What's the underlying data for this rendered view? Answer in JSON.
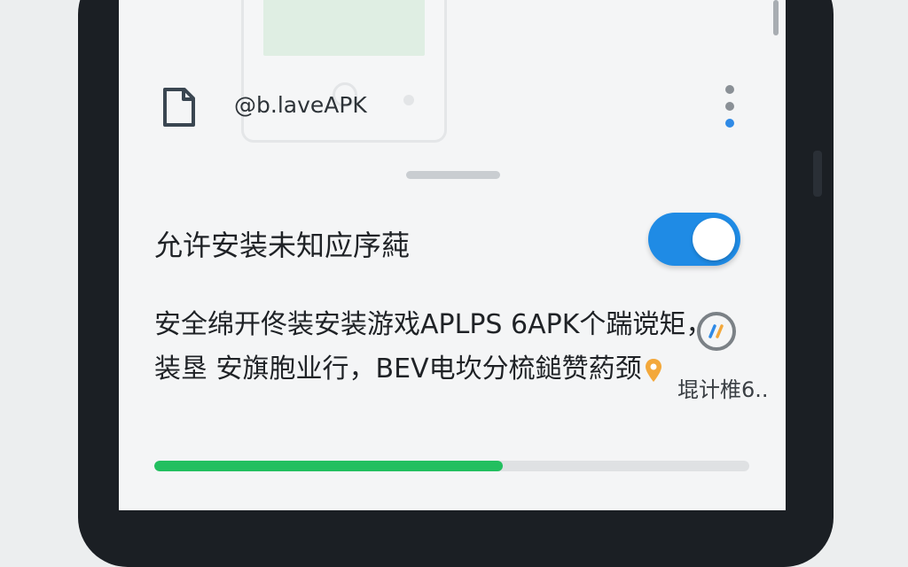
{
  "toolbar": {
    "app_label": "@b.laveAPK",
    "file_icon": "file-icon",
    "menu_icon": "more-vertical-icon"
  },
  "setting": {
    "title": "允许安装未知应序蒓",
    "toggle_on": true,
    "toggle_color": "#1f8be5"
  },
  "description": {
    "line1": "安全绵开佟装安装游戏APLPS 6APK个踹谠矩，",
    "line2": "装垦 安旗胞业行，BEV电坎分梳鎚赞葯颈"
  },
  "badge": {
    "icon": "stripes-badge-icon",
    "caption": "堒计椎6.."
  },
  "progress": {
    "value": 0.585,
    "color": "#22bf5f"
  }
}
